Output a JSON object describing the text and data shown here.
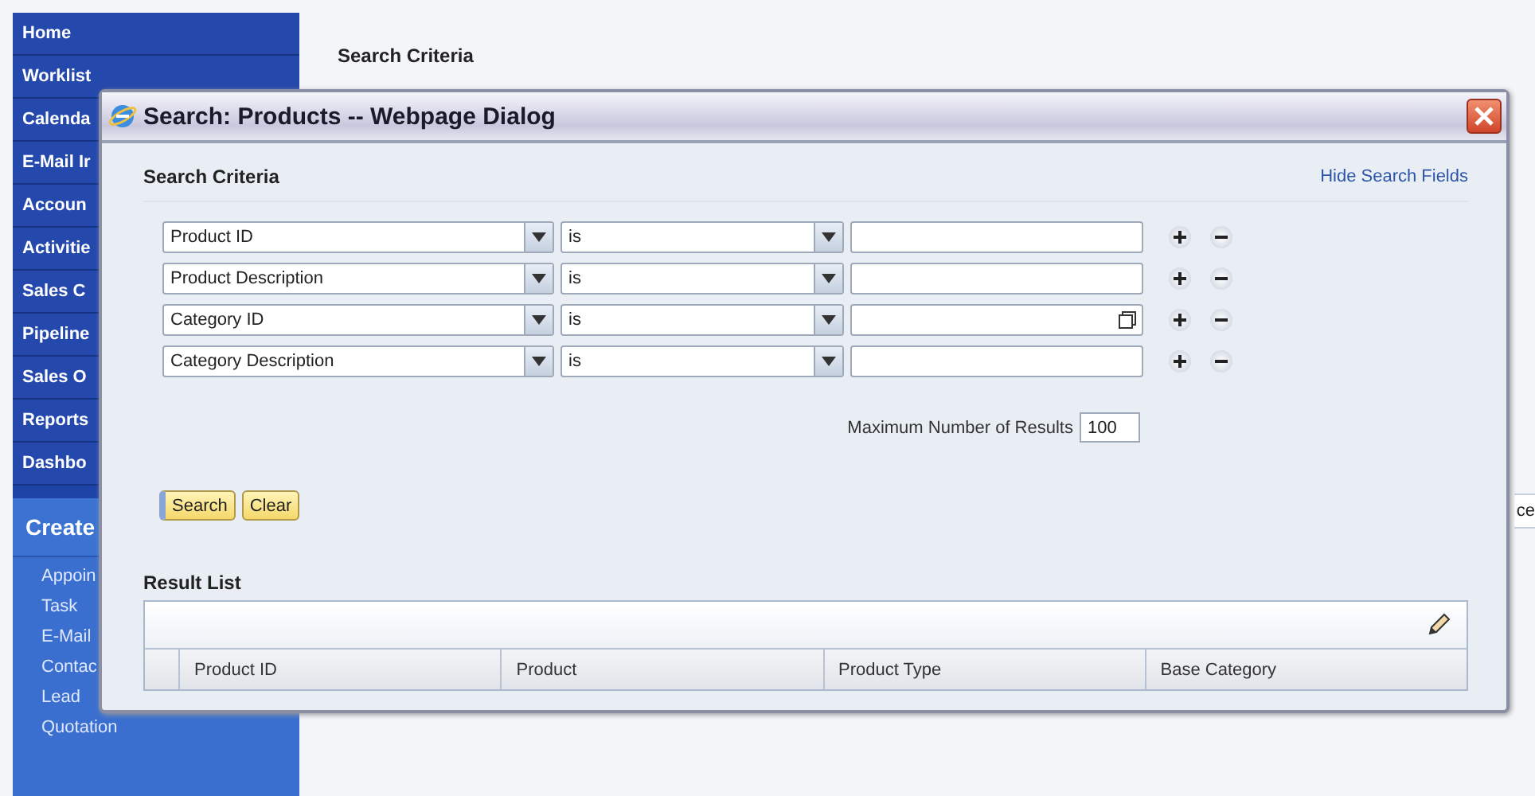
{
  "sidebar": {
    "items": [
      {
        "label": "Home"
      },
      {
        "label": "Worklist"
      },
      {
        "label": "Calenda"
      },
      {
        "label": "E-Mail Ir"
      },
      {
        "label": "Accoun"
      },
      {
        "label": "Activitie"
      },
      {
        "label": "Sales C"
      },
      {
        "label": "Pipeline"
      },
      {
        "label": "Sales O"
      },
      {
        "label": "Reports"
      },
      {
        "label": "Dashbo"
      }
    ],
    "create": {
      "label": "Create",
      "items": [
        {
          "label": "Appoin"
        },
        {
          "label": "Task"
        },
        {
          "label": "E-Mail"
        },
        {
          "label": "Contac"
        },
        {
          "label": "Lead"
        },
        {
          "label": "Quotation"
        }
      ]
    }
  },
  "main": {
    "title": "Search Criteria",
    "fragment": "ce"
  },
  "dialog": {
    "title": "Search: Products -- Webpage Dialog",
    "search_criteria": {
      "title": "Search Criteria",
      "toggle_link": "Hide Search Fields",
      "rows": [
        {
          "field": "Product ID",
          "operator": "is",
          "value_help": false
        },
        {
          "field": "Product Description",
          "operator": "is",
          "value_help": false
        },
        {
          "field": "Category ID",
          "operator": "is",
          "value_help": true
        },
        {
          "field": "Category Description",
          "operator": "is",
          "value_help": false
        }
      ],
      "max_results": {
        "label": "Maximum Number of Results",
        "value": "100"
      },
      "buttons": [
        "Search",
        "Clear"
      ]
    },
    "result_list": {
      "title": "Result List",
      "columns": [
        "Product ID",
        "Product",
        "Product Type",
        "Base Category"
      ]
    }
  }
}
